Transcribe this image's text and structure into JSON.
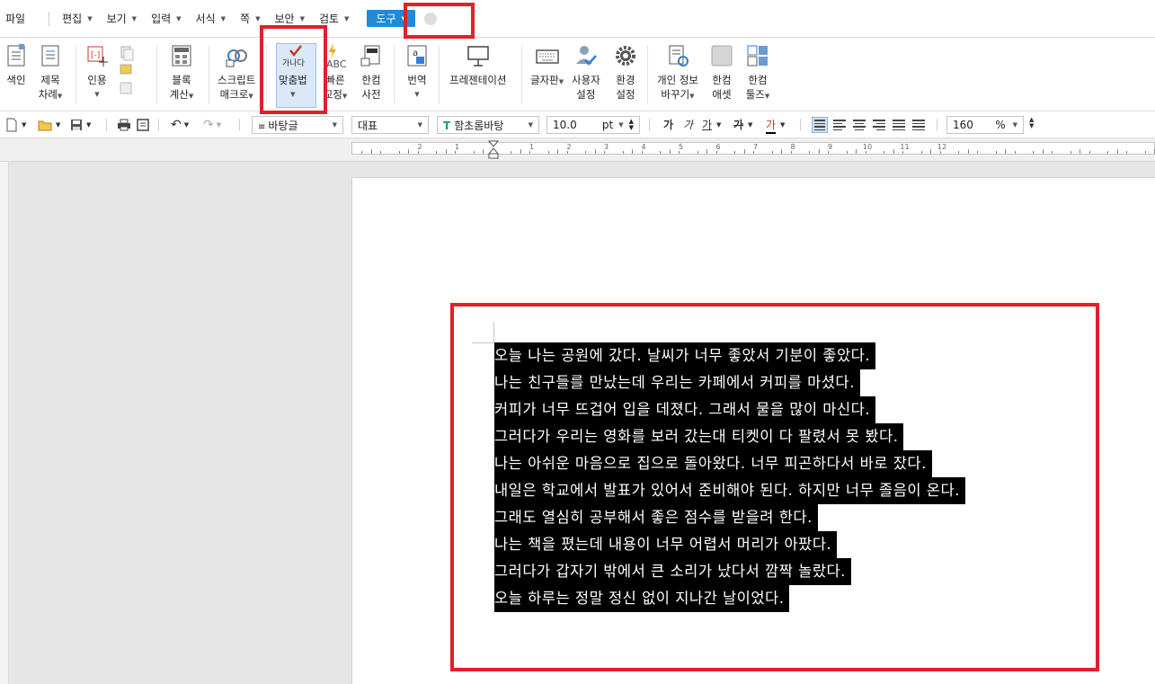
{
  "menubar": {
    "items": [
      {
        "label": "파일",
        "dropdown": false
      },
      {
        "label": "편집",
        "dropdown": true
      },
      {
        "label": "보기",
        "dropdown": true
      },
      {
        "label": "입력",
        "dropdown": true
      },
      {
        "label": "서식",
        "dropdown": true
      },
      {
        "label": "쪽",
        "dropdown": true
      },
      {
        "label": "보안",
        "dropdown": true
      },
      {
        "label": "검토",
        "dropdown": true
      }
    ],
    "active": {
      "label": "도구",
      "color": "#1f8ad8"
    }
  },
  "ribbon": {
    "index": "색인",
    "toc": [
      "제목",
      "차례"
    ],
    "cite": "인용",
    "block_calc": [
      "블록",
      "계산"
    ],
    "script_macro": [
      "스크립트",
      "매크로"
    ],
    "spellcheck": {
      "label": "맞춤법",
      "icon_text": "가나다"
    },
    "quick_fix": {
      "label": [
        "빠른",
        "교정"
      ],
      "icon_text": "ABC"
    },
    "hancom_dict": [
      "한컴",
      "사전"
    ],
    "translate": {
      "label": "번역",
      "icon_text": "a"
    },
    "presentation": "프레젠테이션",
    "keyboard": "글자판",
    "user_settings": [
      "사용자",
      "설정"
    ],
    "env_settings": [
      "환경",
      "설정"
    ],
    "privacy": [
      "개인 정보",
      "바꾸기"
    ],
    "asset": [
      "한컴",
      "애셋"
    ],
    "tools": [
      "한컴",
      "툴즈"
    ]
  },
  "toolbar": {
    "style": "바탕글",
    "lang": "대표",
    "font": "함초롬바탕",
    "font_icon": "T",
    "size": "10.0",
    "size_unit": "pt",
    "bold": "가",
    "italic": "가",
    "underline": "가",
    "strike": "가",
    "color": "가",
    "zoom": "160",
    "zoom_unit": "%"
  },
  "ruler": {
    "numbers": [
      "2",
      "1",
      "1",
      "2",
      "3",
      "4",
      "5",
      "6",
      "7",
      "8",
      "9",
      "10",
      "11",
      "12"
    ]
  },
  "document": {
    "lines": [
      "오늘 나는 공원에 갔다. 날씨가 너무 좋았서 기분이 좋았다.",
      "나는 친구들를 만났는데 우리는 카페에서 커피를 마셨다.",
      "커피가 너무 뜨겁어 입을 데졌다. 그래서 물을 많이 마신다.",
      "그러다가 우리는 영화를 보러 갔는대 티켓이 다 팔렸서 못 봤다.",
      "나는 아쉬운 마음으로 집으로 돌아왔다. 너무 피곤하다서 바로 잤다.",
      "내일은 학교에서 발표가 있어서 준비해야 된다. 하지만 너무 졸음이 온다.",
      "그래도 열심히 공부해서 좋은 점수를 받을려 한다.",
      "나는 책을 폈는데 내용이 너무 어렵서 머리가 아팠다.",
      "그러다가 갑자기 밖에서 큰 소리가 났다서 깜짝 놀랐다.",
      "오늘 하루는 정말 정신 없이 지나간 날이었다."
    ]
  },
  "colors": {
    "highlight": "#e0202a",
    "accent": "#1f8ad8",
    "selection": "#000000"
  }
}
